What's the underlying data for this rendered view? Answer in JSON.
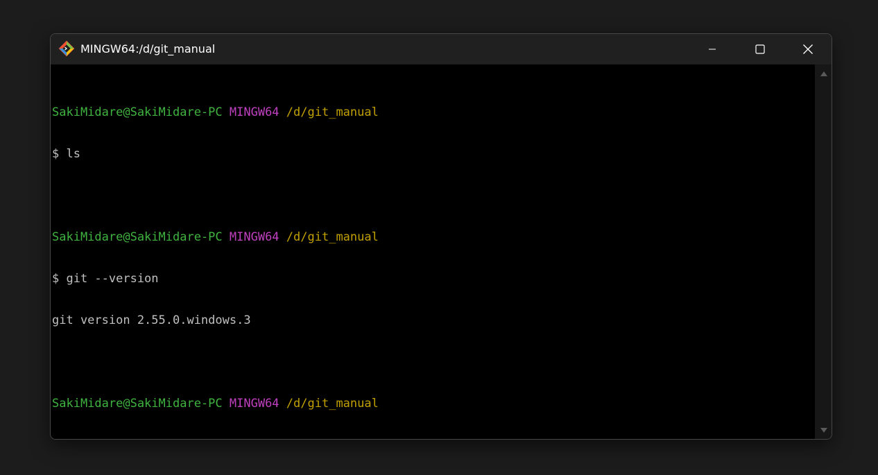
{
  "window": {
    "title": "MINGW64:/d/git_manual",
    "app_icon": "git-bash-icon",
    "controls": {
      "minimize": "minimize-icon",
      "maximize": "maximize-icon",
      "close": "close-icon"
    }
  },
  "terminal": {
    "lines": [
      {
        "user": "SakiMidare@SakiMidare-PC",
        "host": "MINGW64",
        "path": "/d/git_manual"
      },
      {
        "text": "$ ls"
      },
      {
        "text": ""
      },
      {
        "user": "SakiMidare@SakiMidare-PC",
        "host": "MINGW64",
        "path": "/d/git_manual"
      },
      {
        "text": "$ git --version"
      },
      {
        "text": "git version 2.55.0.windows.3"
      },
      {
        "text": ""
      },
      {
        "user": "SakiMidare@SakiMidare-PC",
        "host": "MINGW64",
        "path": "/d/git_manual"
      },
      {
        "text": "$"
      }
    ]
  },
  "colors": {
    "background": "#1c1c1c",
    "terminal_bg": "#000000",
    "titlebar_bg": "#202020",
    "user": "#3fb33f",
    "host": "#bf40bf",
    "path": "#c0a000",
    "text": "#c0c0c0"
  }
}
